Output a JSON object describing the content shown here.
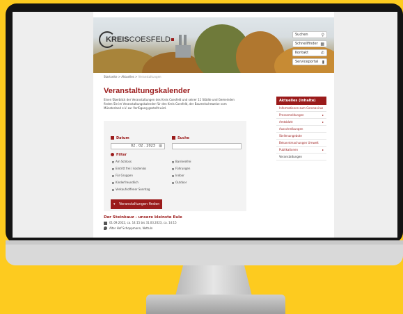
{
  "logo": {
    "text_bold": "KREIS",
    "text_regular": "COESFELD"
  },
  "header_buttons": [
    {
      "label": "Suchen",
      "icon": "search-icon",
      "glyph": "⚲"
    },
    {
      "label": "Schnellfinder",
      "icon": "grid-icon",
      "glyph": "▦"
    },
    {
      "label": "Kontakt",
      "icon": "phone-icon",
      "glyph": "✆"
    },
    {
      "label": "Serviceportal",
      "icon": "portal-icon",
      "glyph": "▮"
    }
  ],
  "breadcrumb": {
    "home": "Startseite",
    "sep": " > ",
    "section": "Aktuelles",
    "current": "Veranstaltungen"
  },
  "main": {
    "title": "Veranstaltungskalender",
    "intro": "Einen Überblick der Veranstaltungen des Kreis Coesfeld und seiner 11 Städte und Gemeinden finden Sie im Veranstaltungskalender für den Kreis Coesfeld, der Baumelscheweise vom Münsterland e.V. zur Verfügung gestellt wird."
  },
  "form": {
    "date_label": "Datum",
    "date_value": "02 . 02 . 2023",
    "search_label": "Suche",
    "filter_label": "Filter",
    "filters_left": [
      "Am Schloss",
      "Eintritt frei / kostenlos",
      "Für Gruppen",
      "Kinderfreundlich",
      "Verkaufsoffener Sonntag"
    ],
    "filters_right": [
      "Barrierefrei",
      "Führungen",
      "Indoor",
      "Outdoor"
    ],
    "submit_label": "Veranstaltungen finden"
  },
  "event": {
    "title": "Der Steinkauz - unsere kleinste Eule",
    "date": "01.09.2022, ca. 14:15 bis 31.03.2023, ca. 14:15",
    "location": "Alter Hof Schoppmann, Nottuln"
  },
  "sidebar": {
    "heading": "Aktuelles (Inhalte)",
    "items": [
      {
        "label": "Informationen zum Coronavirus",
        "chevron": ""
      },
      {
        "label": "Pressemeldungen",
        "chevron": "▸"
      },
      {
        "label": "Amtsblatt",
        "chevron": "▸"
      },
      {
        "label": "Ausschreibungen",
        "chevron": ""
      },
      {
        "label": "Stellenangebote",
        "chevron": ""
      },
      {
        "label": "Bekanntmachungen Umwelt",
        "chevron": ""
      },
      {
        "label": "Publikationen",
        "chevron": "▸"
      },
      {
        "label": "Veranstaltungen",
        "chevron": ""
      }
    ]
  },
  "colors": {
    "accent": "#9b1b1b",
    "background": "#fdcb1f",
    "bezel": "#141414"
  }
}
